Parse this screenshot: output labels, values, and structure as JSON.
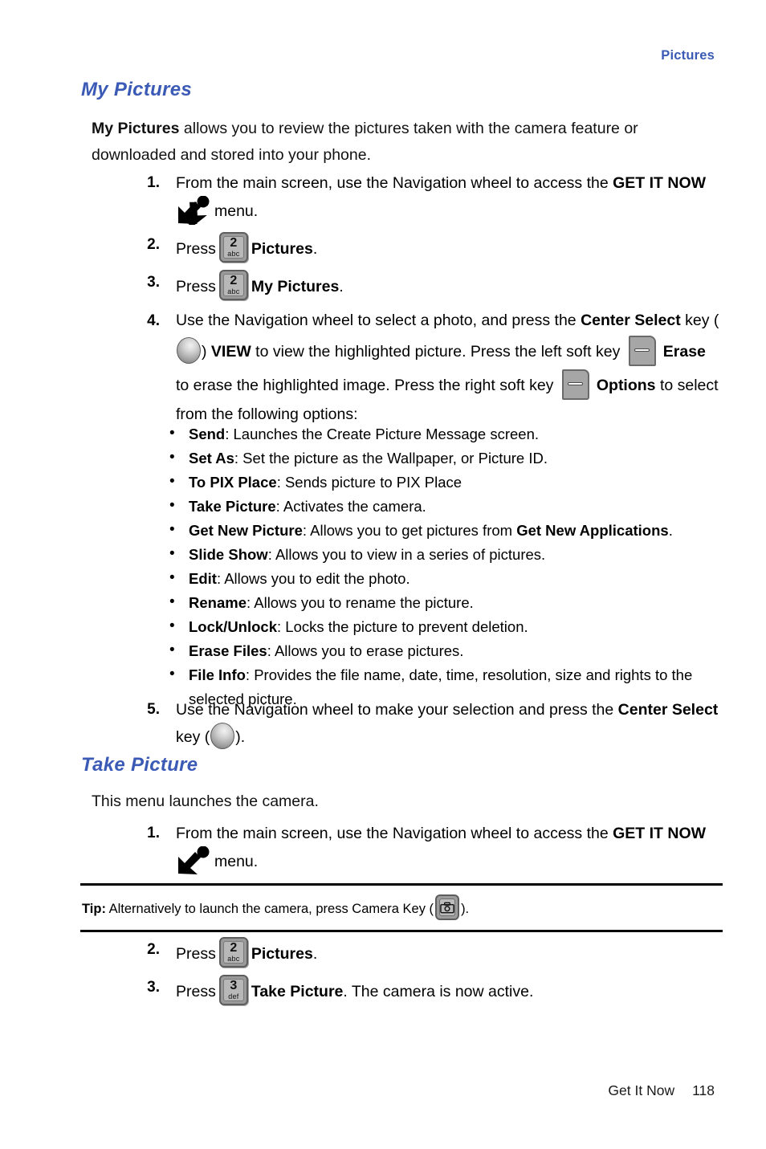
{
  "header": {
    "running_head": "Pictures"
  },
  "sections": [
    {
      "id": "my-pictures",
      "heading": "My Pictures",
      "intro_bold": "My Pictures",
      "intro_rest": " allows you to review the pictures taken with the camera feature or downloaded and stored into your phone."
    },
    {
      "id": "take-picture",
      "heading": "Take Picture",
      "intro": "This menu launches the camera."
    }
  ],
  "steps_my_pictures": [
    {
      "num": "1.",
      "text_a": "From the main screen, use the Navigation wheel to access the ",
      "bold_a": "GET IT NOW",
      "icon": "get-it-now-arrow-icon",
      "text_b": "menu."
    },
    {
      "num": "2.",
      "text_a": "Press",
      "key_digit": "2",
      "key_sub": "abc",
      "bold_a": "Pictures",
      "text_b": "."
    },
    {
      "num": "3.",
      "text_a": "Press",
      "key_digit": "2",
      "key_sub": "abc",
      "bold_a": "My Pictures",
      "text_b": "."
    },
    {
      "num": "4.",
      "t1": "Use the Navigation wheel to select a photo, and press the ",
      "b1": "Center Select",
      "t2": " key (",
      "center_key_icon": "center-select-key-icon",
      "t3": ") ",
      "b2": "VIEW",
      "t4": " to view the highlighted picture. Press the left soft key ",
      "left_soft_key_icon": "left-soft-key-icon",
      "b3": "Erase",
      "t5": " to erase the highlighted image. Press the right soft key ",
      "right_soft_key_icon": "right-soft-key-icon",
      "b4": "Options",
      "t6": " to select from the following options:"
    },
    {
      "num": "5.",
      "t1": "Use the Navigation wheel to make your selection and press the ",
      "b1": "Center Select",
      "t2": " key (",
      "center_key_icon": "center-select-key-icon",
      "t3": ")."
    }
  ],
  "options_bullets": [
    {
      "term": "Send",
      "desc": ": Launches the Create Picture Message screen."
    },
    {
      "term": "Set As",
      "desc": ": Set the picture as the Wallpaper, or Picture ID."
    },
    {
      "term": "To PIX Place",
      "desc": ": Sends picture to PIX Place"
    },
    {
      "term": "Take Picture",
      "desc": ": Activates the camera."
    },
    {
      "term": "Get New Picture",
      "desc_a": ": Allows you to get pictures from ",
      "desc_bold": "Get New Applications",
      "desc_b": "."
    },
    {
      "term": "Slide Show",
      "desc": ": Allows you to view in a series of pictures."
    },
    {
      "term": "Edit",
      "desc": ": Allows you to edit the photo."
    },
    {
      "term": "Rename",
      "desc": ": Allows you to rename the picture."
    },
    {
      "term": "Lock/Unlock",
      "desc": ": Locks the picture to prevent deletion."
    },
    {
      "term": "Erase Files",
      "desc": ": Allows you to erase pictures."
    },
    {
      "term": "File Info",
      "desc": ": Provides the file name, date, time, resolution, size and rights to the selected picture."
    }
  ],
  "steps_take_picture": [
    {
      "num": "1.",
      "text_a": "From the main screen, use the Navigation wheel to access the ",
      "bold_a": "GET IT NOW",
      "icon": "get-it-now-arrow-icon",
      "text_b": "menu."
    },
    {
      "num": "2.",
      "text_a": "Press",
      "key_digit": "2",
      "key_sub": "abc",
      "bold_a": "Pictures",
      "text_b": "."
    },
    {
      "num": "3.",
      "text_a": "Press",
      "key_digit": "3",
      "key_sub": "def",
      "bold_a": "Take Picture",
      "text_b": ". The camera is now active."
    }
  ],
  "tip": {
    "label": "Tip:",
    "text_a": " Alternatively to launch the camera, press Camera Key (",
    "camera_icon": "camera-key-icon",
    "text_b": ")."
  },
  "footer": {
    "label": "Get It Now",
    "page_number": "118"
  },
  "colors": {
    "heading_blue": "#3b5ab5",
    "body_text": "#111111",
    "key_gray": "#b8b8b8",
    "key_border": "#5d5d5d"
  }
}
